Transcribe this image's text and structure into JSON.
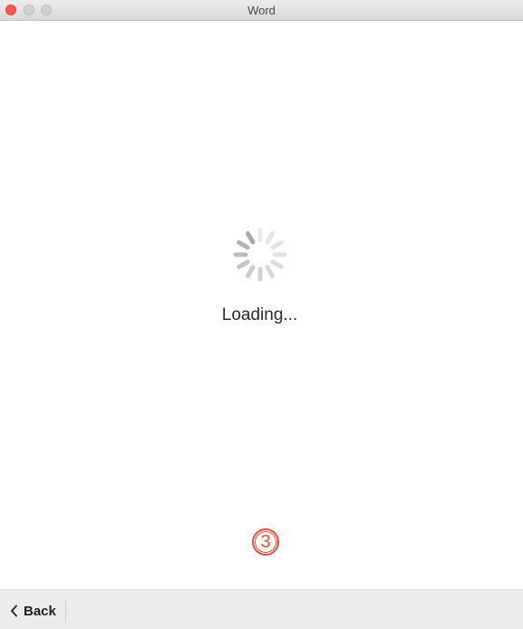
{
  "window": {
    "title": "Word"
  },
  "content": {
    "loading_text": "Loading...",
    "step_badge": "3"
  },
  "bottombar": {
    "back_label": "Back"
  },
  "colors": {
    "close": "#fc5753",
    "accent_badge": "#f04a3a",
    "spinner": "#a9a9a9"
  },
  "icons": {
    "spinner": "loading-spinner-icon",
    "back": "chevron-left-icon"
  }
}
